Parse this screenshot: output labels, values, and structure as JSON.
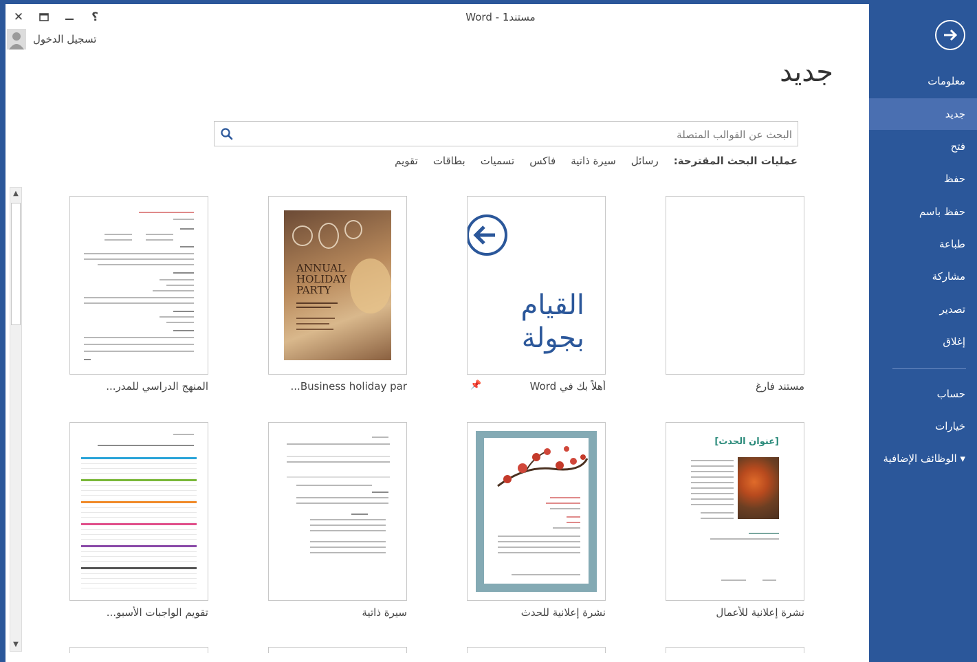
{
  "window": {
    "title": "Word - مستند1",
    "signin": "تسجيل الدخول"
  },
  "sidebar": {
    "items": [
      {
        "label": "معلومات"
      },
      {
        "label": "جديد"
      },
      {
        "label": "فتح"
      },
      {
        "label": "حفظ"
      },
      {
        "label": "حفظ باسم"
      },
      {
        "label": "طباعة"
      },
      {
        "label": "مشاركة"
      },
      {
        "label": "تصدير"
      },
      {
        "label": "إغلاق"
      },
      {
        "label": "حساب"
      },
      {
        "label": "خيارات"
      },
      {
        "label": "الوظائف الإضافية ▾"
      }
    ],
    "active_index": 1
  },
  "main": {
    "heading": "جديد",
    "search": {
      "placeholder": "البحث عن القوالب المتصلة",
      "value": ""
    },
    "suggested": {
      "label": "عمليات البحث المقترحة:",
      "links": [
        "رسائل",
        "سيرة ذاتية",
        "فاكس",
        "تسميات",
        "بطاقات",
        "تقويم"
      ]
    },
    "templates": [
      {
        "label": "مستند فارغ"
      },
      {
        "label": "أهلاً بك في Word",
        "thumb_text": [
          "القيام",
          "بجولة"
        ]
      },
      {
        "label": "Business holiday par...",
        "thumb_text": [
          "ANNUAL",
          "HOLIDAY",
          "PARTY"
        ]
      },
      {
        "label": "المنهج الدراسي للمدر..."
      },
      {
        "label": "نشرة إعلانية للأعمال",
        "thumb_text": [
          "[عنوان الحدث]"
        ]
      },
      {
        "label": "نشرة إعلانية للحدث"
      },
      {
        "label": "سيرة ذاتية"
      },
      {
        "label": "تقويم الواجبات الأسبو..."
      }
    ]
  },
  "colors": {
    "accent": "#2b579a",
    "active_nav": "#4a6fb1"
  }
}
